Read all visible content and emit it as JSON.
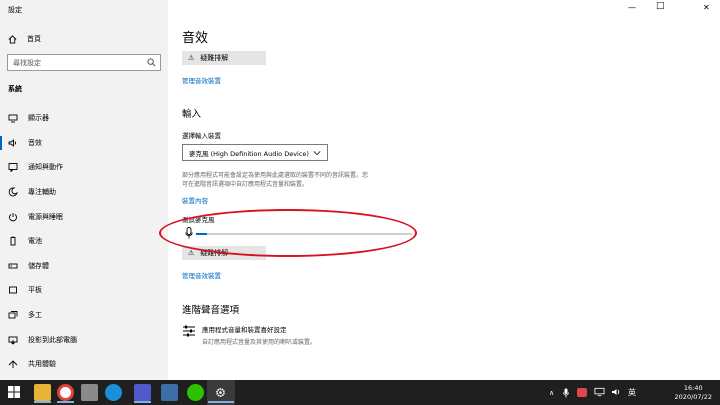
{
  "app": {
    "title": "設定"
  },
  "window": {
    "minimize": "—",
    "maximize": "□",
    "close": "✕"
  },
  "sidebar": {
    "home_label": "首頁",
    "search_placeholder": "尋找設定",
    "section_label": "系統",
    "items": [
      {
        "label": "顯示器",
        "icon": "monitor-icon",
        "active": false
      },
      {
        "label": "音效",
        "icon": "speaker-icon",
        "active": true
      },
      {
        "label": "通知與動作",
        "icon": "notification-icon",
        "active": false
      },
      {
        "label": "專注輔助",
        "icon": "moon-icon",
        "active": false
      },
      {
        "label": "電源與睡眠",
        "icon": "power-icon",
        "active": false
      },
      {
        "label": "電池",
        "icon": "battery-icon",
        "active": false
      },
      {
        "label": "儲存體",
        "icon": "storage-icon",
        "active": false
      },
      {
        "label": "平板",
        "icon": "tablet-icon",
        "active": false
      },
      {
        "label": "多工",
        "icon": "multitask-icon",
        "active": false
      },
      {
        "label": "投影到此部電腦",
        "icon": "project-icon",
        "active": false
      },
      {
        "label": "共用體驗",
        "icon": "share-icon",
        "active": false
      }
    ]
  },
  "main": {
    "title": "音效",
    "troubleshoot_top": "疑難排解",
    "manage_devices_top": "管理音效裝置",
    "input_heading": "輸入",
    "select_label": "選擇輸入裝置",
    "selected_device": "麥克風 (High Definition Audio Device)",
    "description_line1": "部分應用程式可能會設定為使用與此處選取的裝置不同的音訊裝置。您",
    "description_line2": "可在進階音訊選項中自訂應用程式音量和裝置。",
    "device_properties": "裝置內容",
    "test_mic_label": "測試麥克風",
    "mic_level": 0.05,
    "troubleshoot_bottom": "疑難排解",
    "manage_devices_bottom": "管理音效裝置",
    "advanced_heading": "進階聲音選項",
    "advanced_item_title": "應用程式音量和裝置喜好設定",
    "advanced_item_desc": "自訂應用程式音量及其使用的喇叭或裝置。"
  },
  "taskbar": {
    "time": "16:40",
    "date": "2020/07/22",
    "tray_chevron": "∧",
    "accent_color": "#0067c0"
  }
}
